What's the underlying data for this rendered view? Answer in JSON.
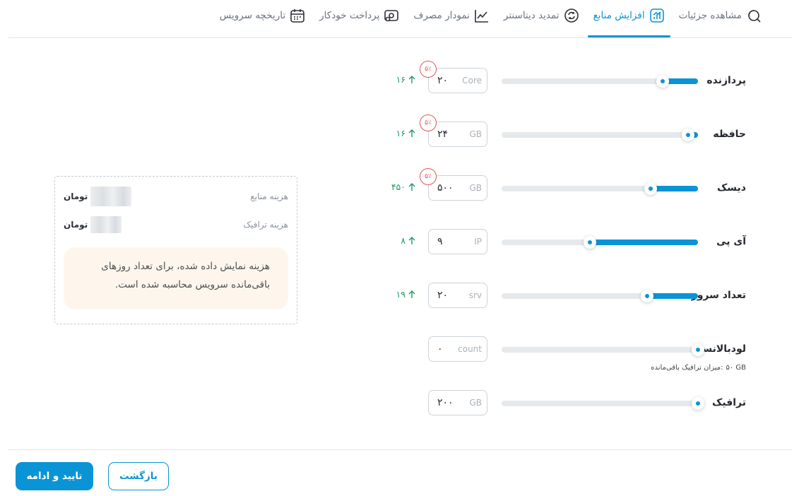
{
  "tabs": [
    {
      "label": "مشاهده جزئیات",
      "icon": "search-detail-icon",
      "active": false
    },
    {
      "label": "افزایش منابع",
      "icon": "chart-bars-icon",
      "active": true
    },
    {
      "label": "تمدید دیتاسنتر",
      "icon": "refresh-icon",
      "active": false
    },
    {
      "label": "نمودار مصرف",
      "icon": "line-chart-icon",
      "active": false
    },
    {
      "label": "پرداخت خودکار",
      "icon": "auto-pay-icon",
      "active": false
    },
    {
      "label": "تاریخچه سرویس",
      "icon": "calendar-icon",
      "active": false
    }
  ],
  "resources": [
    {
      "label": "پردازنده",
      "unit": "Core",
      "value": "۲۰",
      "discount": "۵٪",
      "max": "۱۶",
      "level": 0.18
    },
    {
      "label": "حافظه",
      "unit": "GB",
      "value": "۲۴",
      "discount": "۵٪",
      "max": "۱۶",
      "level": 0.05
    },
    {
      "label": "دیسک",
      "unit": "GB",
      "value": "۵۰۰",
      "discount": "۵٪",
      "max": "۴۵۰",
      "level": 0.24
    },
    {
      "label": "آی پی",
      "unit": "IP",
      "value": "۹",
      "discount": "",
      "max": "۸",
      "level": 0.55
    },
    {
      "label": "تعداد سرور",
      "unit": "srv",
      "value": "۲۰",
      "discount": "",
      "max": "۱۹",
      "level": 0.26
    },
    {
      "label": "لودبالانسر",
      "unit": "count",
      "value": "۰",
      "discount": "",
      "max": "",
      "level": 0.0
    },
    {
      "label": "ترافیک",
      "unit": "GB",
      "value": "۲۰۰",
      "discount": "",
      "max": "",
      "level": 0.0
    }
  ],
  "traffic_note": {
    "label": "میزان ترافیک باقی‌مانده:",
    "value": "۵۰ GB"
  },
  "cost": {
    "resource_label": "هزینه منابع",
    "traffic_label": "هزینه ترافیک",
    "currency": "تومان",
    "info": "هزینه نمایش داده شده، برای تعداد روزهای باقی‌مانده سرویس محاسبه شده است."
  },
  "footer": {
    "confirm_label": "تایید و ادامه",
    "back_label": "بازگشت"
  },
  "colors": {
    "accent": "#0a94d6",
    "success": "#1f9a63",
    "danger": "#e05555",
    "info_bg": "#fef6ec"
  }
}
